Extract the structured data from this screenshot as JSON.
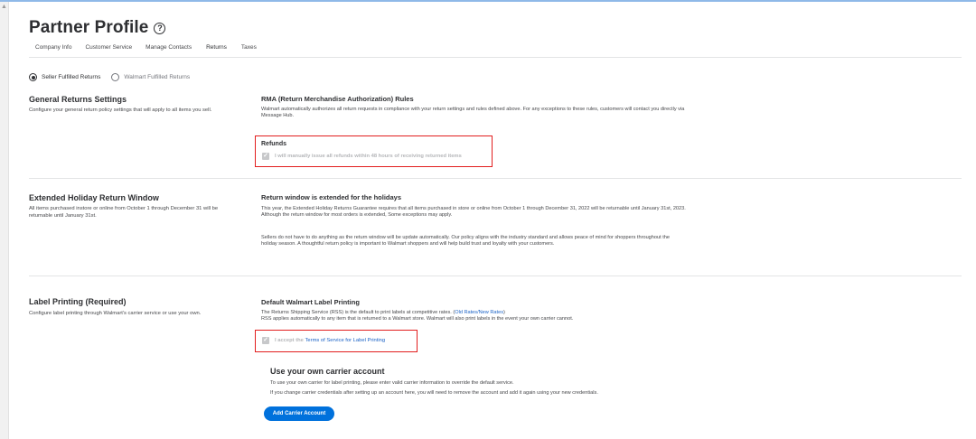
{
  "header": {
    "title": "Partner Profile",
    "help_icon": "?"
  },
  "tabs": [
    {
      "label": "Company Info"
    },
    {
      "label": "Customer Service"
    },
    {
      "label": "Manage Contacts"
    },
    {
      "label": "Returns",
      "active": true
    },
    {
      "label": "Taxes"
    }
  ],
  "fulfillment": {
    "option_seller": "Seller Fulfilled Returns",
    "option_walmart": "Walmart Fulfilled Returns",
    "selected": "Seller Fulfilled Returns"
  },
  "general": {
    "title": "General Returns Settings",
    "desc": "Configure your general return policy settings that will apply to all items you sell.",
    "rma_title": "RMA (Return Merchandise Authorization) Rules",
    "rma_body": "Walmart automatically authorizes all return requests in compliance with your return settings and rules defined above. For any exceptions to these rules, customers will contact you directly via Message Hub.",
    "refunds_title": "Refunds",
    "refunds_check": "I will manually issue all refunds within 48 hours of receiving returned items"
  },
  "holiday": {
    "title": "Extended Holiday Return Window",
    "desc": "All items purchased instore or online from October 1 through December 31 will be returnable until January 31st.",
    "right_title": "Return window is extended for the holidays",
    "para1": "This year, the Extended Holiday Returns Guarantee requires that all items purchased in store or online from October 1 through December 31, 2022 will be returnable until January 31st, 2023. Although the return window for most orders is extended, Some exceptions may apply.",
    "para2": "Sellers do not have to do anything as the return window will be update automatically. Our policy aligns with the industry standard and allows peace of mind for shoppers throughout the holiday season. A thoughtful return policy is important to Walmart shoppers and will help build trust and loyalty with your customers."
  },
  "label_printing": {
    "title": "Label Printing (Required)",
    "desc": "Configure label printing through Walmart's carrier service or use your own.",
    "right_title": "Default Walmart Label Printing",
    "line1_prefix": "The Returns Shipping Service (RSS) is the default to print labels at competitive rates. (",
    "line1_link": "Old Rates/New Rates",
    "line1_suffix": ")",
    "line2": "RSS applies automatically to any item that is returned to a Walmart store. Walmart will also print labels in the event your own carrier cannot.",
    "accept_prefix": "I accept the",
    "accept_link": "Terms of Service for Label Printing",
    "own_title": "Use your own carrier account",
    "own_line1": "To use your own carrier for label printing, please enter valid carrier information to override the default service.",
    "own_line2": "If you change carrier credentials after setting up an account here, you will need to remove the account and add it again using your new credentials.",
    "button": "Add Carrier Account"
  },
  "colors": {
    "accent": "#0071dc",
    "highlight": "#e21e1e",
    "link": "#1a62c6"
  }
}
